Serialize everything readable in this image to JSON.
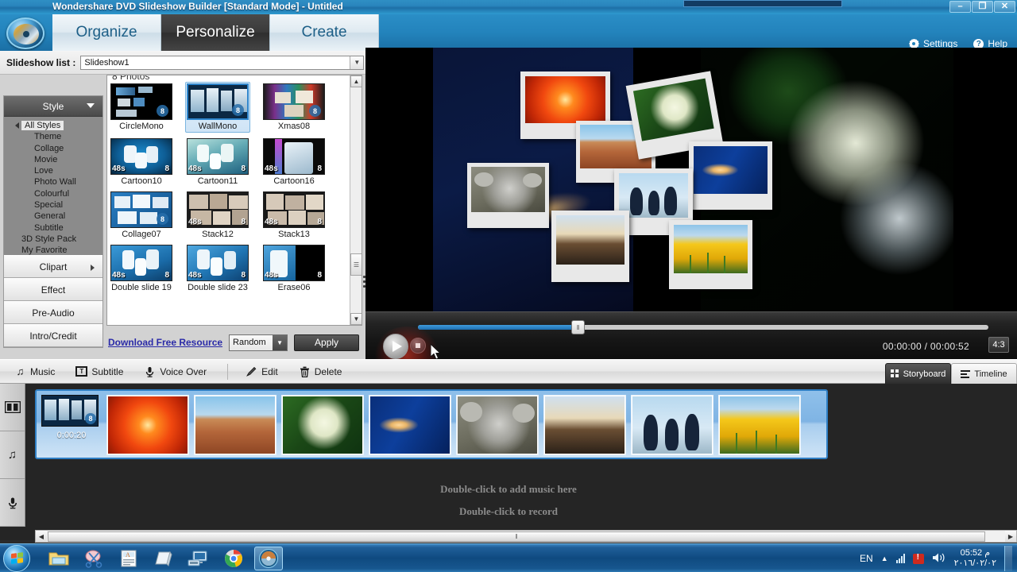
{
  "window": {
    "title": "Wondershare DVD Slideshow Builder [Standard Mode] - Untitled",
    "minimize": "–",
    "maximize": "❐",
    "close": "✕"
  },
  "ribbon": {
    "tabs": [
      {
        "label": "Organize",
        "active": false
      },
      {
        "label": "Personalize",
        "active": true
      },
      {
        "label": "Create",
        "active": false
      }
    ],
    "settings_label": "Settings",
    "help_label": "Help",
    "help_glyph": "?"
  },
  "slideshow_list": {
    "label": "Slideshow list :",
    "value": "Slideshow1",
    "arrow": "▼"
  },
  "style_panel": {
    "header": "Style",
    "caret": "▼",
    "tree": [
      {
        "label": "All Styles",
        "level": 0,
        "selected": true
      },
      {
        "label": "Theme",
        "level": 1,
        "selected": false
      },
      {
        "label": "Collage",
        "level": 1,
        "selected": false
      },
      {
        "label": "Movie",
        "level": 1,
        "selected": false
      },
      {
        "label": "Love",
        "level": 1,
        "selected": false
      },
      {
        "label": "Photo Wall",
        "level": 1,
        "selected": false
      },
      {
        "label": "Colourful",
        "level": 1,
        "selected": false
      },
      {
        "label": "Special",
        "level": 1,
        "selected": false
      },
      {
        "label": "General",
        "level": 1,
        "selected": false
      },
      {
        "label": "Subtitle",
        "level": 1,
        "selected": false
      },
      {
        "label": "3D Style Pack",
        "level": 0,
        "selected": false
      },
      {
        "label": "My Favorite",
        "level": 0,
        "selected": false
      }
    ],
    "buttons": [
      {
        "label": "Clipart",
        "has_arrow": true
      },
      {
        "label": "Effect",
        "has_arrow": false
      },
      {
        "label": "Pre-Audio",
        "has_arrow": false
      },
      {
        "label": "Intro/Credit",
        "has_arrow": false
      }
    ]
  },
  "style_browser": {
    "photo_count": "8 Photos",
    "scroll_up": "▲",
    "scroll_down": "▼",
    "thumb_grip": "☰",
    "items": [
      {
        "name": "CircleMono",
        "badge": "8",
        "duration": "",
        "selected": false,
        "kind": "circlemono"
      },
      {
        "name": "WallMono",
        "badge": "8",
        "duration": "",
        "selected": true,
        "kind": "wallmono"
      },
      {
        "name": "Xmas08",
        "badge": "8",
        "duration": "",
        "selected": false,
        "kind": "xmas"
      },
      {
        "name": "Cartoon10",
        "badge": "8",
        "duration": "48s",
        "selected": false,
        "kind": "cartoon10"
      },
      {
        "name": "Cartoon11",
        "badge": "8",
        "duration": "48s",
        "selected": false,
        "kind": "cartoon11"
      },
      {
        "name": "Cartoon16",
        "badge": "8",
        "duration": "48s",
        "selected": false,
        "kind": "cartoon16"
      },
      {
        "name": "Collage07",
        "badge": "8",
        "duration": "",
        "selected": false,
        "kind": "collage07"
      },
      {
        "name": "Stack12",
        "badge": "8",
        "duration": "48s",
        "selected": false,
        "kind": "stack12"
      },
      {
        "name": "Stack13",
        "badge": "8",
        "duration": "48s",
        "selected": false,
        "kind": "stack13"
      },
      {
        "name": "Double slide 19",
        "badge": "8",
        "duration": "48s",
        "selected": false,
        "kind": "dslide19"
      },
      {
        "name": "Double slide 23",
        "badge": "8",
        "duration": "48s",
        "selected": false,
        "kind": "dslide23"
      },
      {
        "name": "Erase06",
        "badge": "8",
        "duration": "48s",
        "selected": false,
        "kind": "erase06"
      }
    ],
    "download_link": "Download Free Resource",
    "transition_value": "Random",
    "transition_arrow": "▼",
    "apply_label": "Apply"
  },
  "player": {
    "current_time": "00:00:00",
    "total_time": "00:00:52",
    "timecode": "00:00:00 / 00:00:52",
    "aspect_ratio": "4:3",
    "play_label": "Play",
    "stop_label": "Stop",
    "progress_percent": 27,
    "knob_glyph": "‖"
  },
  "toolbar": {
    "items": [
      {
        "label": "Music",
        "icon": "music-note-icon"
      },
      {
        "label": "Subtitle",
        "icon": "subtitle-icon"
      },
      {
        "label": "Voice Over",
        "icon": "microphone-icon"
      },
      {
        "label": "Edit",
        "icon": "pencil-icon"
      },
      {
        "label": "Delete",
        "icon": "trash-icon"
      }
    ],
    "music_glyph": "♫",
    "subtitle_glyph": "T",
    "mic_glyph": "ƨ",
    "pencil_glyph": "✎",
    "trash_glyph": "☰"
  },
  "view_tabs": [
    {
      "label": "Storyboard",
      "active": true
    },
    {
      "label": "Timeline",
      "active": false
    }
  ],
  "storyboard": {
    "first_duration": "0:00:20",
    "first_badge": "8",
    "rail": [
      {
        "icon": "filmstrip-icon",
        "glyph": "▤"
      },
      {
        "icon": "music-note-icon",
        "glyph": "♫"
      },
      {
        "icon": "microphone-icon",
        "glyph": "ƨ"
      }
    ],
    "clips": [
      {
        "name": "orange-chrysanthemum",
        "kind": "flower"
      },
      {
        "name": "desert-butte",
        "kind": "canyon"
      },
      {
        "name": "white-hydrangea",
        "kind": "hydrangea"
      },
      {
        "name": "blue-comet",
        "kind": "comet"
      },
      {
        "name": "koala-bear",
        "kind": "koala"
      },
      {
        "name": "lighthouse-sunset",
        "kind": "lighthouse"
      },
      {
        "name": "emperor-penguins",
        "kind": "penguins"
      },
      {
        "name": "yellow-tulips",
        "kind": "tulips"
      }
    ],
    "add_music_hint": "Double-click to add music here",
    "record_hint": "Double-click to record"
  },
  "scrollbars": {
    "left_arrow": "◀",
    "right_arrow": "▶",
    "grip": "‖"
  },
  "taskbar": {
    "apps": [
      {
        "name": "windows-explorer-icon",
        "active": false
      },
      {
        "name": "snipping-tool-icon",
        "active": false
      },
      {
        "name": "wordpad-icon",
        "active": false
      },
      {
        "name": "notepad-icon",
        "active": false
      },
      {
        "name": "remote-desktop-icon",
        "active": false
      },
      {
        "name": "google-chrome-icon",
        "active": false
      },
      {
        "name": "dvd-slideshow-builder-icon",
        "active": true
      }
    ],
    "language": "EN",
    "time": "05:52 م",
    "date": "٢٠١٦/٠٢/٠٢",
    "show_desktop": "Show desktop",
    "tray_up": "▲"
  },
  "colors": {
    "title_blue": "#2383bc",
    "accent_blue": "#2f86cd",
    "active_tab_dark": "#333333",
    "link_blue": "#2a2aa8",
    "storyboard_blue": "#7fb4e4"
  }
}
